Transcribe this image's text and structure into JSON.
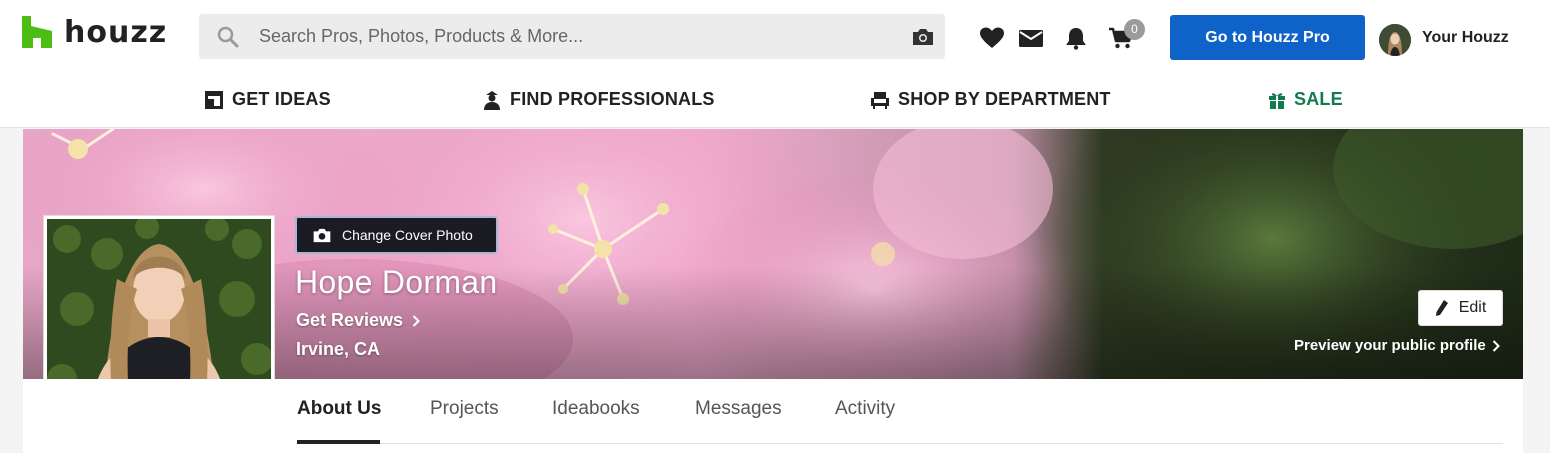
{
  "header": {
    "logo_text": "houzz",
    "search_placeholder": "Search Pros, Photos, Products & More...",
    "cart_count": "0",
    "pro_button_label": "Go to Houzz Pro",
    "account_label": "Your Houzz",
    "icons": [
      "search-icon",
      "camera-icon",
      "heart-icon",
      "mail-icon",
      "bell-icon",
      "cart-icon"
    ]
  },
  "nav": {
    "items": [
      {
        "label": "GET IDEAS",
        "icon": "ideas-icon"
      },
      {
        "label": "FIND PROFESSIONALS",
        "icon": "professional-icon"
      },
      {
        "label": "SHOP BY DEPARTMENT",
        "icon": "shop-icon"
      },
      {
        "label": "SALE",
        "icon": "gift-icon"
      }
    ],
    "sale_color": "#117a4f"
  },
  "profile": {
    "change_cover_label": "Change Cover Photo",
    "name": "Hope Dorman",
    "get_reviews_label": "Get Reviews",
    "location": "Irvine, CA",
    "edit_label": "Edit",
    "preview_label": "Preview your public profile"
  },
  "tabs": [
    {
      "label": "About Us",
      "active": true
    },
    {
      "label": "Projects",
      "active": false
    },
    {
      "label": "Ideabooks",
      "active": false
    },
    {
      "label": "Messages",
      "active": false
    },
    {
      "label": "Activity",
      "active": false
    }
  ],
  "colors": {
    "brand_green": "#4dbc15",
    "pro_blue": "#0f62c7"
  }
}
